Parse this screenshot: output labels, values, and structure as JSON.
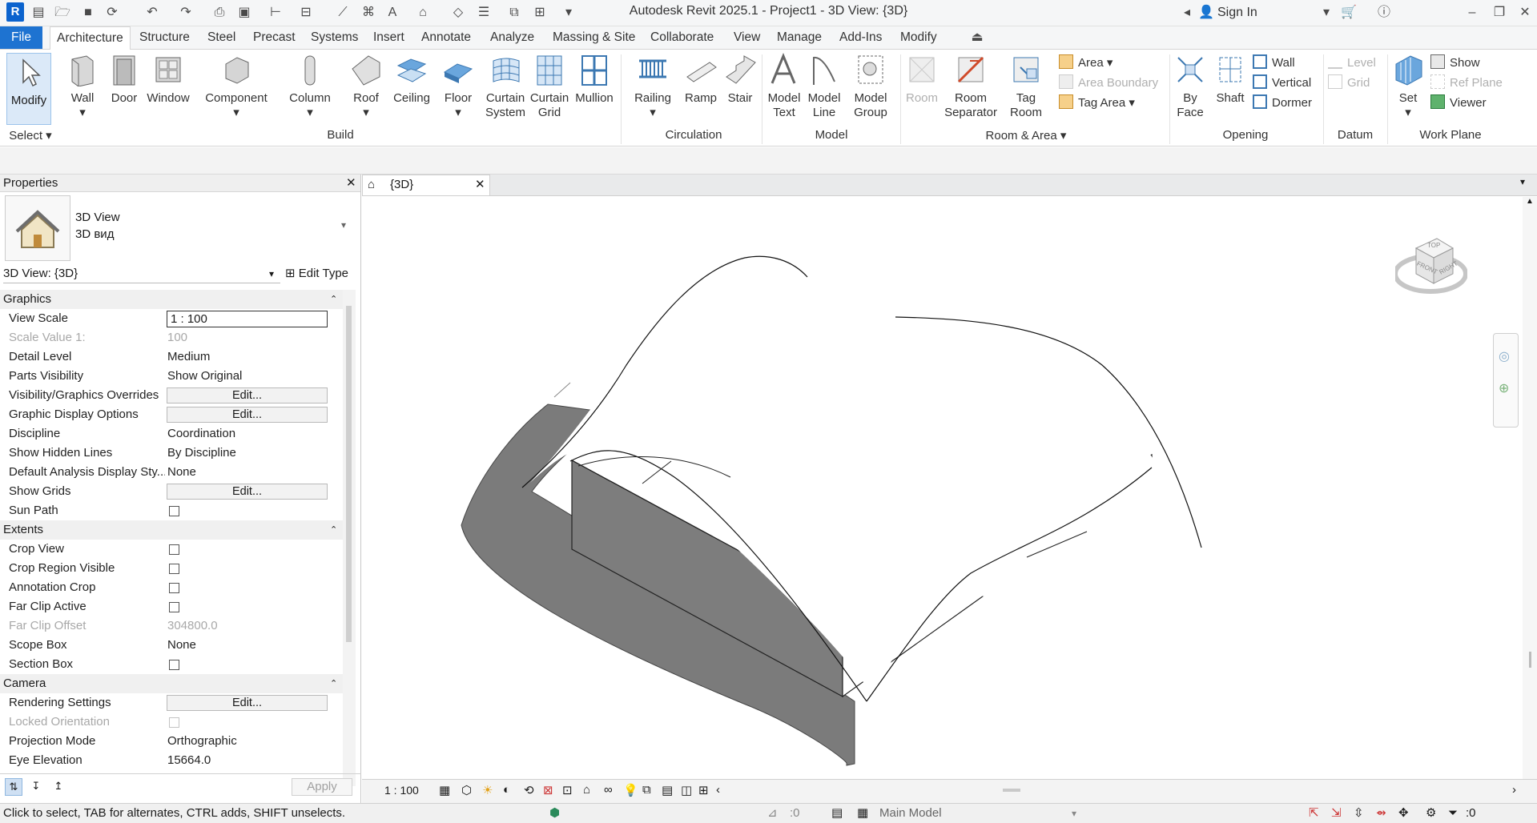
{
  "app": {
    "logo": "R",
    "window_title": "Autodesk Revit 2025.1 - Project1 - 3D View: {3D}",
    "sign_in": "Sign In"
  },
  "tabs": [
    "File",
    "Architecture",
    "Structure",
    "Steel",
    "Precast",
    "Systems",
    "Insert",
    "Annotate",
    "Analyze",
    "Massing & Site",
    "Collaborate",
    "View",
    "Manage",
    "Add-Ins",
    "Modify"
  ],
  "ribbon": {
    "modify": "Modify",
    "select": "Select",
    "build": {
      "wall": "Wall",
      "door": "Door",
      "window": "Window",
      "component": "Component",
      "column": "Column",
      "roof": "Roof",
      "ceiling": "Ceiling",
      "floor": "Floor",
      "curtain_system_1": "Curtain",
      "curtain_system_2": "System",
      "curtain_grid_1": "Curtain",
      "curtain_grid_2": "Grid",
      "mullion": "Mullion",
      "group": "Build"
    },
    "circulation": {
      "railing": "Railing",
      "ramp": "Ramp",
      "stair": "Stair",
      "group": "Circulation"
    },
    "model": {
      "text_1": "Model",
      "text_2": "Text",
      "line_1": "Model",
      "line_2": "Line",
      "group_1": "Model",
      "group_2": "Group",
      "group": "Model"
    },
    "room_area": {
      "room": "Room",
      "sep_1": "Room",
      "sep_2": "Separator",
      "tag_1": "Tag",
      "tag_2": "Room",
      "area": "Area",
      "area_boundary": "Area  Boundary",
      "tag_area": "Tag  Area",
      "group": "Room & Area"
    },
    "opening": {
      "byface_1": "By",
      "byface_2": "Face",
      "shaft": "Shaft",
      "wall": "Wall",
      "vertical": "Vertical",
      "dormer": "Dormer",
      "group": "Opening"
    },
    "datum": {
      "level": "Level",
      "grid": "Grid",
      "group": "Datum"
    },
    "workplane": {
      "set": "Set",
      "show": "Show",
      "ref_plane": "Ref  Plane",
      "viewer": "Viewer",
      "group": "Work Plane"
    }
  },
  "properties": {
    "title": "Properties",
    "type_name": "3D View",
    "type_sub": "3D вид",
    "instance": "3D View: {3D}",
    "edit_type": "Edit Type",
    "categories": {
      "graphics": "Graphics",
      "extents": "Extents",
      "camera": "Camera"
    },
    "rows": {
      "view_scale": {
        "k": "View Scale",
        "v": "1 : 100"
      },
      "scale_value": {
        "k": "Scale Value    1:",
        "v": "100"
      },
      "detail_level": {
        "k": "Detail Level",
        "v": "Medium"
      },
      "parts_vis": {
        "k": "Parts Visibility",
        "v": "Show Original"
      },
      "vg_over": {
        "k": "Visibility/Graphics Overrides",
        "v": "Edit..."
      },
      "gdo": {
        "k": "Graphic Display Options",
        "v": "Edit..."
      },
      "discipline": {
        "k": "Discipline",
        "v": "Coordination"
      },
      "hidden_lines": {
        "k": "Show Hidden Lines",
        "v": "By Discipline"
      },
      "analysis": {
        "k": "Default Analysis Display Sty...",
        "v": "None"
      },
      "show_grids": {
        "k": "Show Grids",
        "v": "Edit..."
      },
      "sun_path": {
        "k": "Sun Path"
      },
      "crop_view": {
        "k": "Crop View"
      },
      "crop_region": {
        "k": "Crop Region Visible"
      },
      "annot_crop": {
        "k": "Annotation Crop"
      },
      "far_clip_active": {
        "k": "Far Clip Active"
      },
      "far_clip_offset": {
        "k": "Far Clip Offset",
        "v": "304800.0"
      },
      "scope_box": {
        "k": "Scope Box",
        "v": "None"
      },
      "section_box": {
        "k": "Section Box"
      },
      "render": {
        "k": "Rendering Settings",
        "v": "Edit..."
      },
      "locked_orient": {
        "k": "Locked Orientation"
      },
      "projection": {
        "k": "Projection Mode",
        "v": "Orthographic"
      },
      "eye_elev": {
        "k": "Eye Elevation",
        "v": "15664.0"
      }
    },
    "apply": "Apply"
  },
  "view": {
    "tab_label": "{3D}",
    "scale": "1 : 100",
    "cube_top": "TOP",
    "cube_front": "FRONT",
    "cube_right": "RIGHT"
  },
  "status": {
    "hint": "Click to select, TAB for alternates, CTRL adds, SHIFT unselects.",
    "ws_count": ":0",
    "model": "Main Model",
    "filter_count": ":0"
  }
}
